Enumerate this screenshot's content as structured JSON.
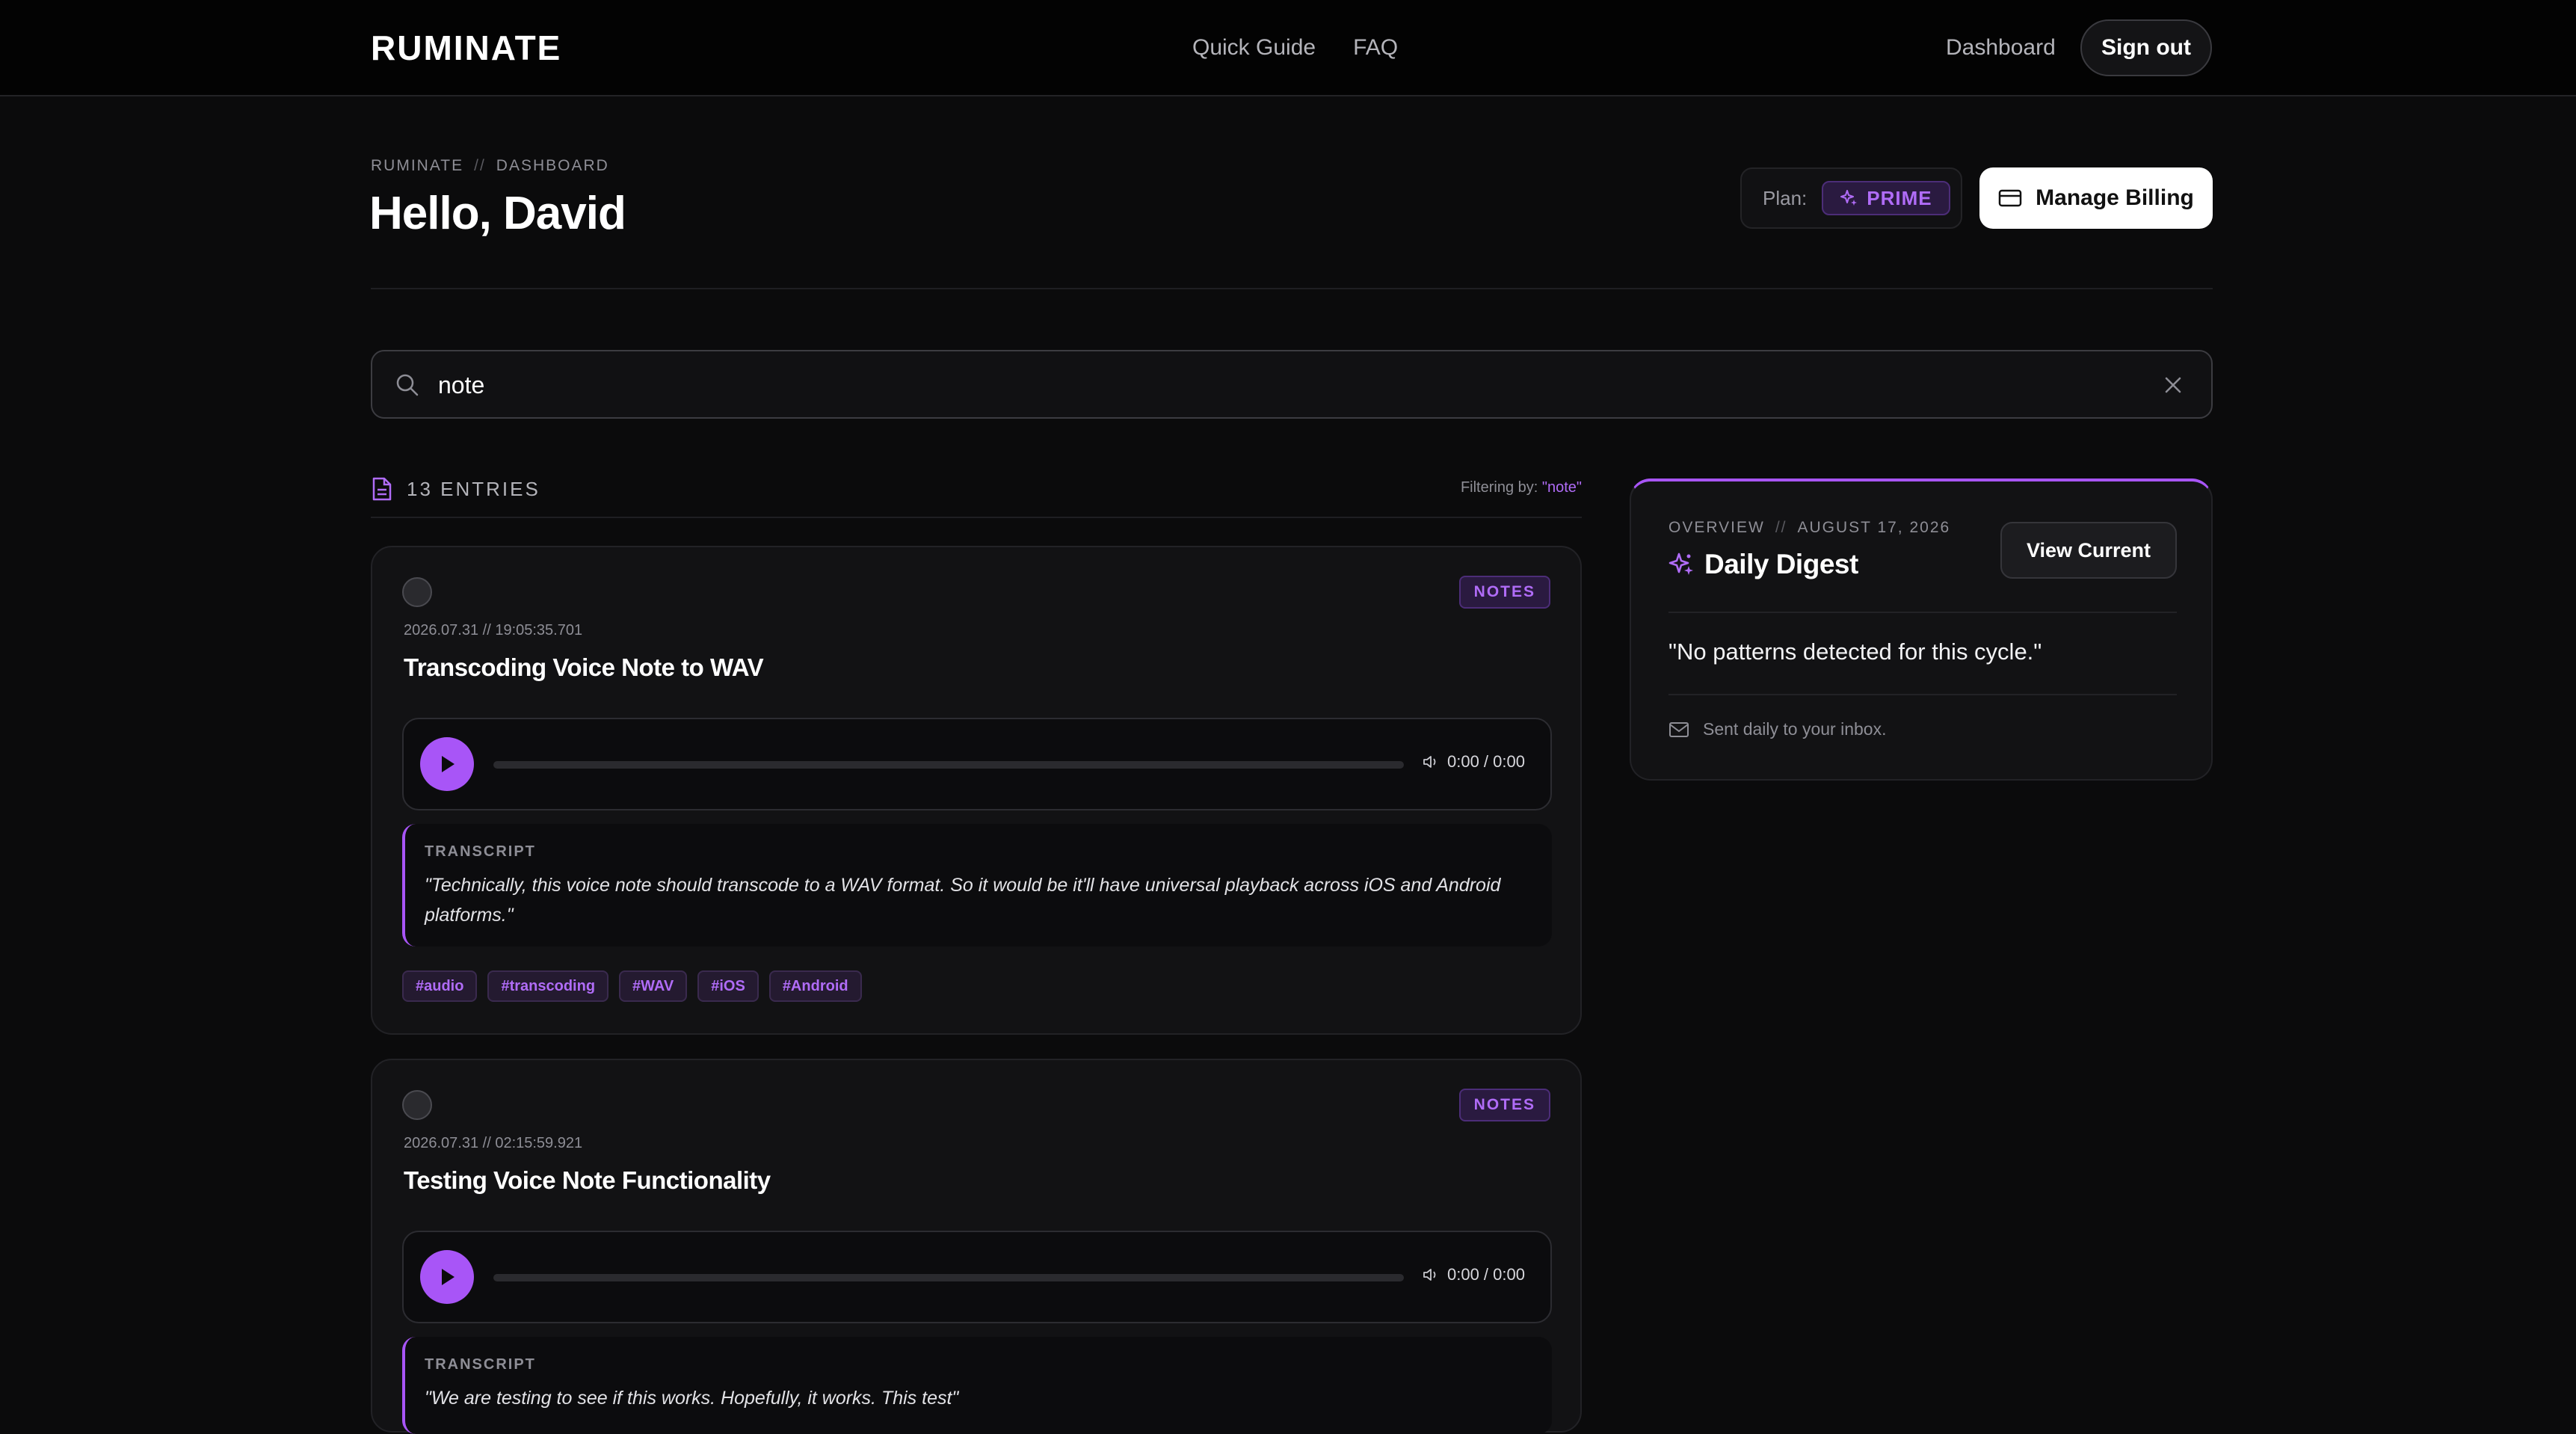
{
  "header": {
    "logo": "RUMINATE",
    "nav": [
      "Quick Guide",
      "FAQ"
    ],
    "dashboard_link": "Dashboard",
    "signout_label": "Sign out"
  },
  "page": {
    "breadcrumb": [
      "RUMINATE",
      "DASHBOARD"
    ],
    "breadcrumb_sep": "//",
    "greeting": "Hello, David",
    "plan_label": "Plan:",
    "plan_name": "PRIME",
    "billing_label": "Manage Billing"
  },
  "search": {
    "value": "note"
  },
  "entries": {
    "count_label": "13 ENTRIES",
    "filter_prefix": "Filtering by:",
    "filter_query": "\"note\"",
    "items": [
      {
        "category": "NOTES",
        "timestamp": "2026.07.31 // 19:05:35.701",
        "title": "Transcoding Voice Note to WAV",
        "time": "0:00 / 0:00",
        "transcript_label": "TRANSCRIPT",
        "transcript": "\"Technically, this voice note should transcode to a WAV format. So it would be it'll have universal playback across iOS and Android platforms.\"",
        "tags": [
          "#audio",
          "#transcoding",
          "#WAV",
          "#iOS",
          "#Android"
        ]
      },
      {
        "category": "NOTES",
        "timestamp": "2026.07.31 // 02:15:59.921",
        "title": "Testing Voice Note Functionality",
        "time": "0:00 / 0:00",
        "transcript_label": "TRANSCRIPT",
        "transcript": "\"We are testing to see if this works. Hopefully, it works. This test\""
      }
    ]
  },
  "digest": {
    "overview": "OVERVIEW",
    "sep": "//",
    "date": "AUGUST 17, 2026",
    "title": "Daily Digest",
    "view_label": "View Current",
    "quote": "\"No patterns detected for this cycle.\"",
    "footer": "Sent daily to your inbox."
  },
  "colors": {
    "accent": "#a855f7",
    "background": "#0b0b0c",
    "card": "#121214"
  }
}
